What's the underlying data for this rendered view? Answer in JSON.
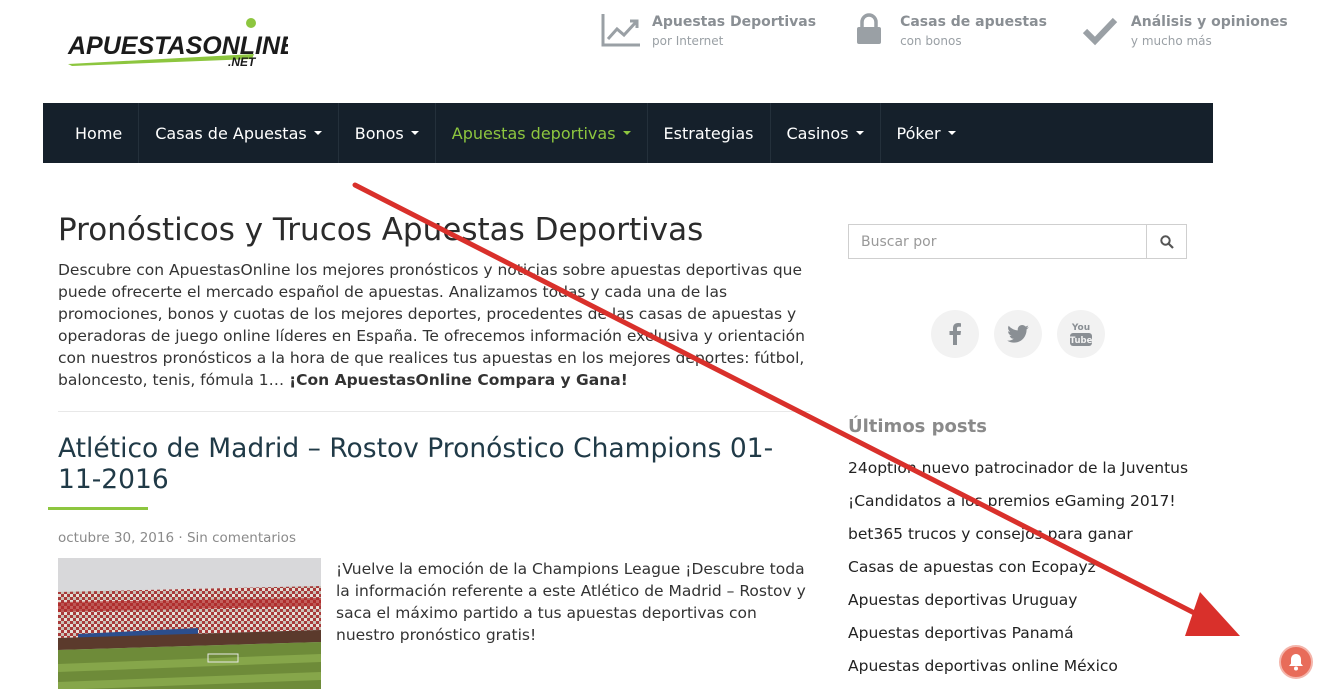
{
  "header": {
    "logo_text": "APUESTASONLINE",
    "logo_sub": ".NET",
    "features": [
      {
        "icon": "chart-trend-icon",
        "title": "Apuestas Deportivas",
        "subtitle": "por Internet"
      },
      {
        "icon": "lock-icon",
        "title": "Casas de apuestas",
        "subtitle": "con bonos"
      },
      {
        "icon": "checkmark-icon",
        "title": "Análisis y opiniones",
        "subtitle": "y mucho más"
      }
    ]
  },
  "nav": {
    "items": [
      {
        "label": "Home",
        "dropdown": false,
        "active": false
      },
      {
        "label": "Casas de Apuestas",
        "dropdown": true,
        "active": false
      },
      {
        "label": "Bonos",
        "dropdown": true,
        "active": false
      },
      {
        "label": "Apuestas deportivas",
        "dropdown": true,
        "active": true
      },
      {
        "label": "Estrategias",
        "dropdown": false,
        "active": false
      },
      {
        "label": "Casinos",
        "dropdown": true,
        "active": false
      },
      {
        "label": "Póker",
        "dropdown": true,
        "active": false
      }
    ]
  },
  "main": {
    "title": "Pronósticos y Trucos Apuestas Deportivas",
    "intro": "Descubre con ApuestasOnline los mejores pronósticos y noticias sobre apuestas deportivas que puede ofrecerte el mercado español de apuestas. Analizamos todas y cada una de las promociones, bonos y cuotas de los mejores deportes, procedentes de las casas de apuestas y operadoras de juego online líderes en España. Te ofrecemos información exclusiva y orientación con nuestros pronósticos a la hora de que realices tus apuestas en los mejores deportes: fútbol, baloncesto, tenis, fómula 1… ",
    "intro_bold": "¡Con ApuestasOnline Compara y Gana!",
    "post": {
      "title": "Atlético de Madrid – Rostov Pronóstico Champions 01-11-2016",
      "date": "octubre 30, 2016",
      "separator": " · ",
      "comments": "Sin comentarios",
      "excerpt": "¡Vuelve la emoción de la Champions League ¡Descubre toda la información referente a este  Atlético de Madrid – Rostov  y saca el máximo partido a tus apuestas deportivas con nuestro pronóstico gratis!"
    }
  },
  "sidebar": {
    "search_placeholder": "Buscar por",
    "socials": [
      "facebook-icon",
      "twitter-icon",
      "youtube-icon"
    ],
    "youtube_label": "You Tube",
    "recent_title": "Últimos posts",
    "recent_posts": [
      "24option nuevo patrocinador de la Juventus",
      "¡Candidatos a los premios eGaming 2017!",
      "bet365 trucos y consejos para ganar",
      "Casas de apuestas con Ecopayz",
      "Apuestas deportivas Uruguay",
      "Apuestas deportivas Panamá",
      "Apuestas deportivas online México"
    ]
  },
  "colors": {
    "nav_bg": "#15202b",
    "accent": "#8dc63f",
    "post_title": "#203a47",
    "annotation_arrow": "#d9302b"
  }
}
